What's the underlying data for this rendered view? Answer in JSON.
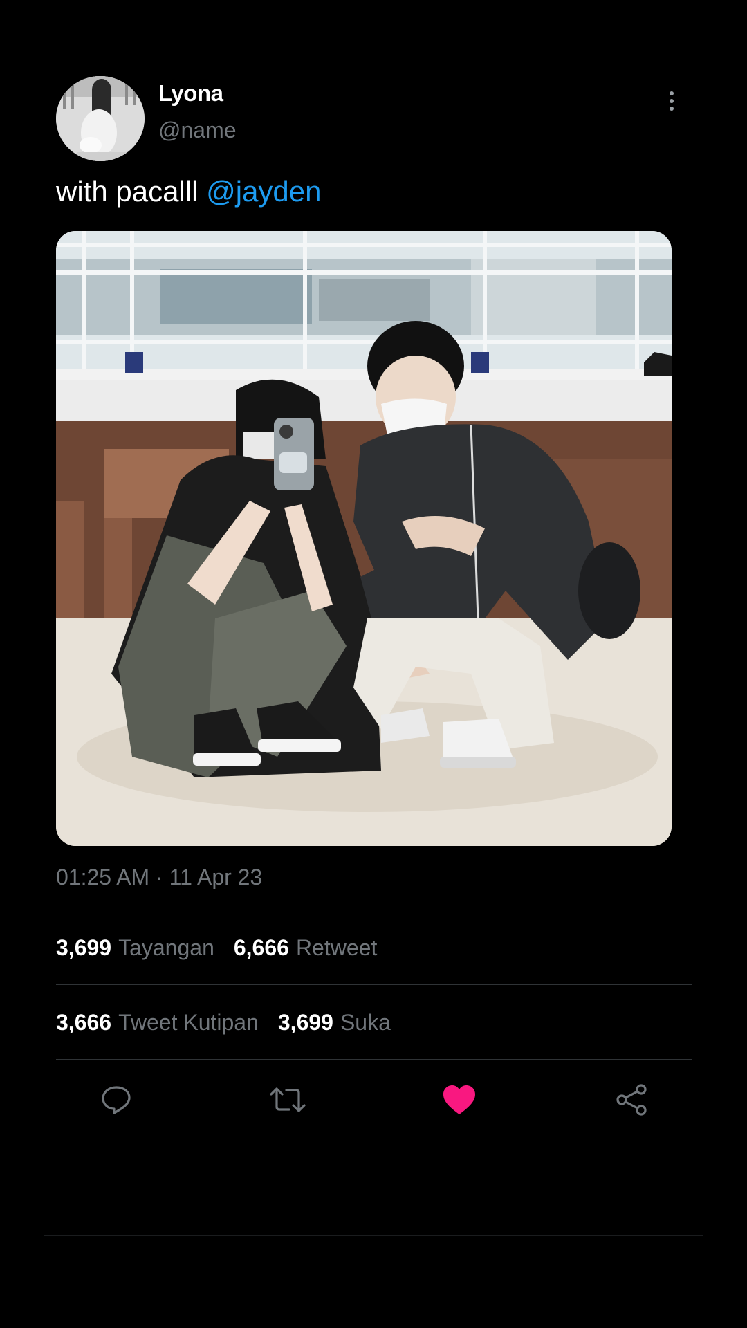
{
  "user": {
    "display_name": "Lyona",
    "handle": "@name"
  },
  "tweet": {
    "text": "with pacalll ",
    "mention": "@jayden",
    "timestamp": "01:25 AM · 11 Apr 23"
  },
  "stats": {
    "views_count": "3,699",
    "views_label": "Tayangan",
    "retweets_count": "6,666",
    "retweets_label": "Retweet",
    "quotes_count": "3,666",
    "quotes_label": "Tweet Kutipan",
    "likes_count": "3,699",
    "likes_label": "Suka"
  },
  "actions": {
    "reply_icon": "reply-icon",
    "retweet_icon": "retweet-icon",
    "like_icon": "heart-icon",
    "share_icon": "share-icon",
    "liked": true
  },
  "colors": {
    "background": "#000000",
    "mention": "#1d9bf0",
    "secondary_text": "#71767b",
    "like_active": "#f91880",
    "divider": "#2f3336"
  }
}
